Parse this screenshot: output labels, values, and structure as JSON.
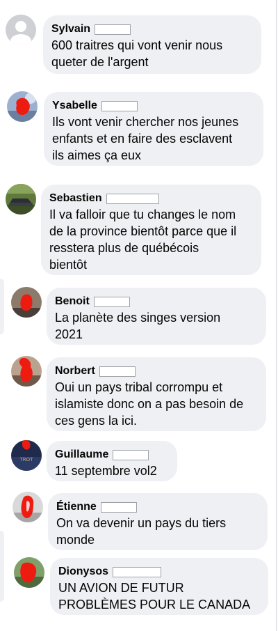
{
  "comments": [
    {
      "name": "Sylvain",
      "text": "600 traitres qui vont venir nous\nqueter de l'argent",
      "avatar_icon": "default-profile-icon"
    },
    {
      "name": "Ysabelle",
      "text": "Ils vont venir chercher nos jeunes\nenfants et en faire des esclavent\nils aimes ça eux",
      "avatar_icon": "redacted-photo-icon"
    },
    {
      "name": "Sebastien",
      "text": "Il va falloir que tu changes le nom\nde la province bientôt parce que il\nresstera plus de québécois\nbientôt",
      "avatar_icon": "car-photo-icon"
    },
    {
      "name": "Benoit",
      "text": "La planète des singes version\n2021",
      "avatar_icon": "redacted-photo-icon"
    },
    {
      "name": "Norbert",
      "text": "Oui un pays tribal  corrompu et\nislamiste donc on a pas besoin de\nces gens la ici.",
      "avatar_icon": "redacted-photo-icon"
    },
    {
      "name": "Guillaume",
      "text": "11 septembre vol2",
      "avatar_icon": "redacted-photo-icon"
    },
    {
      "name": "Étienne",
      "text": "On va devenir un pays du tiers\nmonde",
      "avatar_icon": "redacted-photo-icon"
    },
    {
      "name": "Dionysos",
      "text": "UN AVION DE FUTUR\nPROBLÈMES POUR LE CANADA",
      "avatar_icon": "redacted-photo-icon"
    }
  ],
  "colors": {
    "bubble": "#eff0f3",
    "text": "#050505",
    "redaction_scribble": "#ee1c10"
  }
}
